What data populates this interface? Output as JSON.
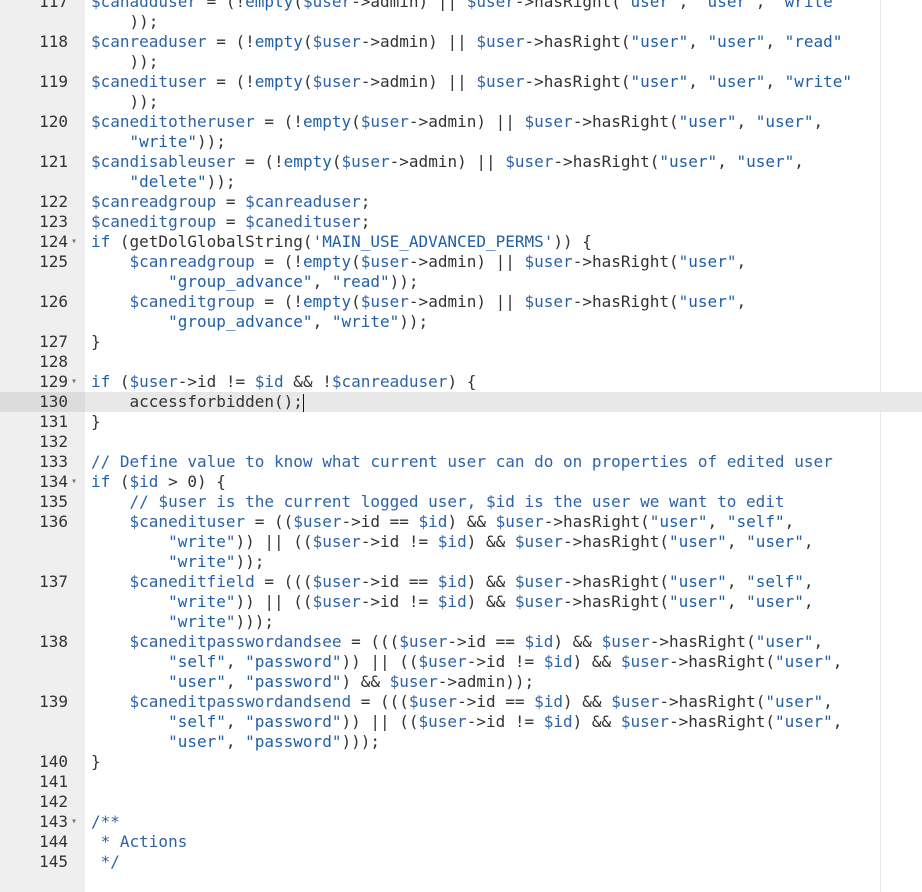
{
  "editor": {
    "lines": [
      {
        "text": "$canadduser = (!empty($user->admin) || $user->hasRight(\"user\", \"user\", \"write\""
      },
      {
        "text": "    ));"
      },
      {
        "text": "$canreaduser = (!empty($user->admin) || $user->hasRight(\"user\", \"user\", \"read\""
      },
      {
        "text": "    ));"
      },
      {
        "text": "$canedituser = (!empty($user->admin) || $user->hasRight(\"user\", \"user\", \"write\""
      },
      {
        "text": "    ));"
      },
      {
        "text": "$caneditotheruser = (!empty($user->admin) || $user->hasRight(\"user\", \"user\","
      },
      {
        "text": "    \"write\"));"
      },
      {
        "text": "$candisableuser = (!empty($user->admin) || $user->hasRight(\"user\", \"user\","
      },
      {
        "text": "    \"delete\"));"
      },
      {
        "text": "$canreadgroup = $canreaduser;"
      },
      {
        "text": "$caneditgroup = $canedituser;"
      },
      {
        "text": "if (getDolGlobalString('MAIN_USE_ADVANCED_PERMS')) {"
      },
      {
        "text": "    $canreadgroup = (!empty($user->admin) || $user->hasRight(\"user\","
      },
      {
        "text": "        \"group_advance\", \"read\"));"
      },
      {
        "text": "    $caneditgroup = (!empty($user->admin) || $user->hasRight(\"user\","
      },
      {
        "text": "        \"group_advance\", \"write\"));"
      },
      {
        "text": "}"
      },
      {
        "text": ""
      },
      {
        "text": "if ($user->id != $id && !$canreaduser) {"
      },
      {
        "text": "    accessforbidden();"
      },
      {
        "text": "}"
      },
      {
        "text": ""
      },
      {
        "text": "// Define value to know what current user can do on properties of edited user"
      },
      {
        "text": "if ($id > 0) {"
      },
      {
        "text": "    // $user is the current logged user, $id is the user we want to edit"
      },
      {
        "text": "    $canedituser = (($user->id == $id) && $user->hasRight(\"user\", \"self\","
      },
      {
        "text": "        \"write\")) || (($user->id != $id) && $user->hasRight(\"user\", \"user\","
      },
      {
        "text": "        \"write\"));"
      },
      {
        "text": "    $caneditfield = ((($user->id == $id) && $user->hasRight(\"user\", \"self\","
      },
      {
        "text": "        \"write\")) || (($user->id != $id) && $user->hasRight(\"user\", \"user\","
      },
      {
        "text": "        \"write\")));"
      },
      {
        "text": "    $caneditpasswordandsee = ((($user->id == $id) && $user->hasRight(\"user\","
      },
      {
        "text": "        \"self\", \"password\")) || (($user->id != $id) && $user->hasRight(\"user\","
      },
      {
        "text": "        \"user\", \"password\") && $user->admin));"
      },
      {
        "text": "    $caneditpasswordandsend = ((($user->id == $id) && $user->hasRight(\"user\","
      },
      {
        "text": "        \"self\", \"password\")) || (($user->id != $id) && $user->hasRight(\"user\","
      },
      {
        "text": "        \"user\", \"password\")));"
      },
      {
        "text": "}"
      },
      {
        "text": ""
      },
      {
        "text": ""
      },
      {
        "text": "/**"
      },
      {
        "text": " * Actions"
      },
      {
        "text": " */"
      }
    ],
    "gutter": [
      {
        "number": "117",
        "fold": ""
      },
      {
        "number": "",
        "fold": ""
      },
      {
        "number": "118",
        "fold": ""
      },
      {
        "number": "",
        "fold": ""
      },
      {
        "number": "119",
        "fold": ""
      },
      {
        "number": "",
        "fold": ""
      },
      {
        "number": "120",
        "fold": ""
      },
      {
        "number": "",
        "fold": ""
      },
      {
        "number": "121",
        "fold": ""
      },
      {
        "number": "",
        "fold": ""
      },
      {
        "number": "122",
        "fold": ""
      },
      {
        "number": "123",
        "fold": ""
      },
      {
        "number": "124",
        "fold": "▾"
      },
      {
        "number": "125",
        "fold": ""
      },
      {
        "number": "",
        "fold": ""
      },
      {
        "number": "126",
        "fold": ""
      },
      {
        "number": "",
        "fold": ""
      },
      {
        "number": "127",
        "fold": ""
      },
      {
        "number": "128",
        "fold": ""
      },
      {
        "number": "129",
        "fold": "▾"
      },
      {
        "number": "130",
        "fold": ""
      },
      {
        "number": "131",
        "fold": ""
      },
      {
        "number": "132",
        "fold": ""
      },
      {
        "number": "133",
        "fold": ""
      },
      {
        "number": "134",
        "fold": "▾"
      },
      {
        "number": "135",
        "fold": ""
      },
      {
        "number": "136",
        "fold": ""
      },
      {
        "number": "",
        "fold": ""
      },
      {
        "number": "",
        "fold": ""
      },
      {
        "number": "137",
        "fold": ""
      },
      {
        "number": "",
        "fold": ""
      },
      {
        "number": "",
        "fold": ""
      },
      {
        "number": "138",
        "fold": ""
      },
      {
        "number": "",
        "fold": ""
      },
      {
        "number": "",
        "fold": ""
      },
      {
        "number": "139",
        "fold": ""
      },
      {
        "number": "",
        "fold": ""
      },
      {
        "number": "",
        "fold": ""
      },
      {
        "number": "140",
        "fold": ""
      },
      {
        "number": "141",
        "fold": ""
      },
      {
        "number": "142",
        "fold": ""
      },
      {
        "number": "143",
        "fold": "▾"
      },
      {
        "number": "144",
        "fold": ""
      },
      {
        "number": "145",
        "fold": ""
      }
    ],
    "active_line": "130",
    "cursor_after": "accessforbidden();"
  },
  "colors": {
    "gutter_bg": "#efefef",
    "active_line_bg": "#e8e8e8",
    "variable": "#2e63a8",
    "plain": "#333333"
  }
}
